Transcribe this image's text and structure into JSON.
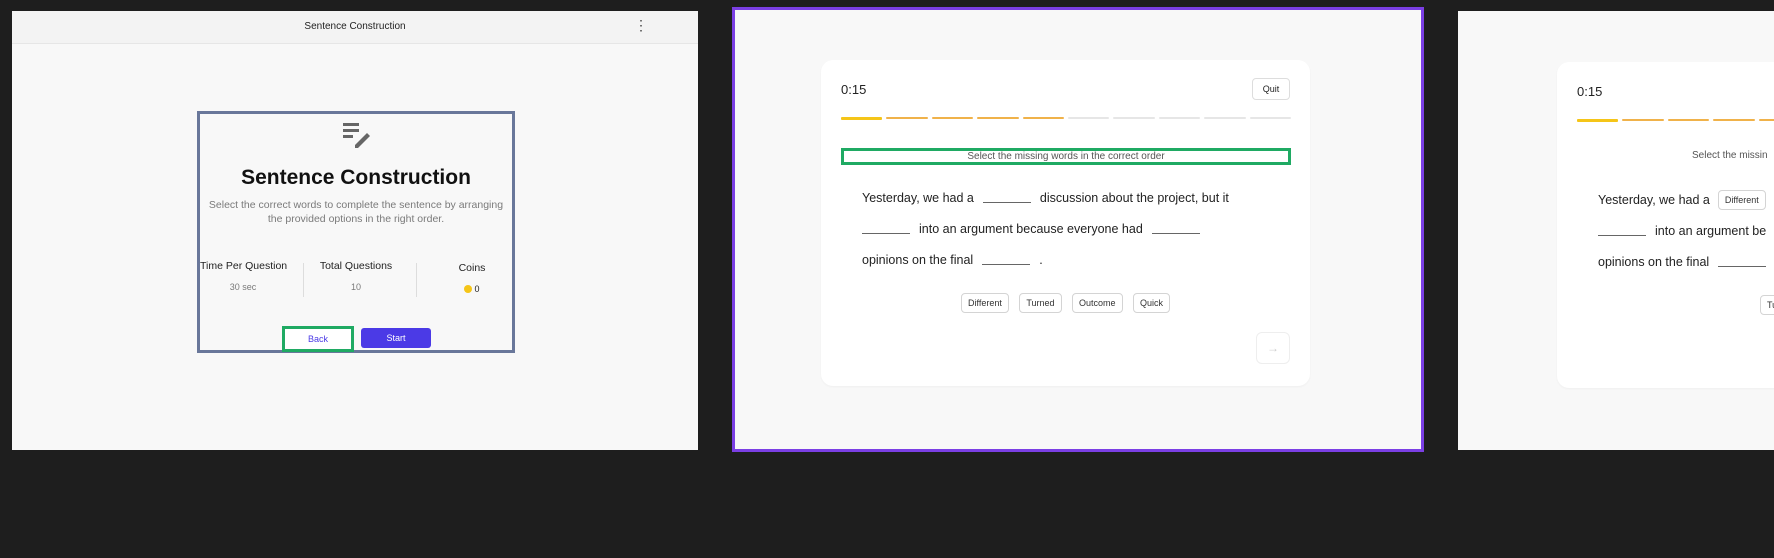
{
  "frame1": {
    "header_title": "Sentence Construction",
    "menu_icon": "kebab-icon",
    "intro": {
      "icon": "notes-pencil-icon",
      "title": "Sentence Construction",
      "description": "Select the correct words to complete the sentence by arranging the provided options in the right order.",
      "stats": [
        {
          "label": "Time Per Question",
          "value": "30 sec"
        },
        {
          "label": "Total Questions",
          "value": "10"
        },
        {
          "label": "Coins",
          "value": "0"
        }
      ],
      "back_label": "Back",
      "start_label": "Start"
    }
  },
  "frame2": {
    "timer": "0:15",
    "quit_label": "Quit",
    "progress": {
      "total": 10,
      "completed": 5
    },
    "instruction": "Select the missing words in the correct order",
    "sentence": {
      "line1_a": "Yesterday, we had a",
      "line1_b": "discussion about the project, but it",
      "line2_a": "into an argument because everyone had",
      "line3_a": "opinions on the final",
      "line3_end": "."
    },
    "options": [
      "Different",
      "Turned",
      "Outcome",
      "Quick"
    ],
    "next_icon": "arrow-right-icon"
  },
  "frame3": {
    "timer": "0:15",
    "instruction": "Select the missin",
    "sentence": {
      "line1_a": "Yesterday, we had a",
      "filled_word": "Different",
      "line2_a": "into an argument be",
      "line3_a": "opinions on the final"
    },
    "option_partial": "Tu"
  },
  "colors": {
    "accent": "#4b3ae6",
    "highlight_green": "#1faa63",
    "selected_frame": "#7b3fe4",
    "progress": "#f0b24a"
  }
}
